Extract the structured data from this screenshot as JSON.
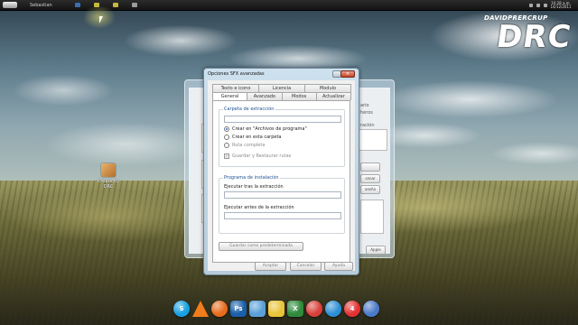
{
  "taskbar": {
    "user": "Sebastian",
    "clock_time": "10:28 a.m.",
    "clock_date": "14/12/2011",
    "buttons": [
      {
        "name": "taskbar-app-1",
        "color": "#3a6fb0"
      },
      {
        "name": "taskbar-app-2",
        "color": "#c7b640"
      },
      {
        "name": "taskbar-app-3",
        "color": "#c7b640"
      },
      {
        "name": "taskbar-app-4",
        "color": "#9b9b9b"
      }
    ]
  },
  "logo": {
    "small_text": "DAVIDPRERCRUP",
    "big_text": "DRC"
  },
  "desktop_icon": {
    "label": "Create by DRC",
    "icon": "package-box-icon"
  },
  "background_window": {
    "labels": [
      "ario",
      "heros",
      "ración",
      "cenar",
      "aseña",
      "Ayuda",
      "Apple"
    ],
    "values": [
      "ovo"
    ]
  },
  "dialog": {
    "title": "Opciones SFX avanzadas",
    "tabs_row1": [
      "Texto e icono",
      "Licencia",
      "Modulo"
    ],
    "tabs_row2": [
      "General",
      "Avanzado",
      "Modos",
      "Actualizar"
    ],
    "group_extract": {
      "title": "Carpeta de extracción",
      "path_value": "",
      "radio_create_program_files": "Crear en \"Archivos de programa\"",
      "radio_create_current": "Crear en esta carpeta",
      "radio_absolute": "Ruta completa",
      "check_save_restore": "Guardar y Restaurar rutas"
    },
    "group_setup": {
      "title": "Programa de instalación",
      "run_after_label": "Ejecutar tras la extracción",
      "run_after_value": "",
      "run_before_label": "Ejecutar antes de la extracción",
      "run_before_value": ""
    },
    "save_default_button": "Guardar como predeterminada",
    "ok_button": "Aceptar",
    "cancel_button": "Cancelar",
    "help_button": "Ayuda",
    "close_glyph": "×"
  },
  "dock": {
    "items": [
      {
        "name": "skype-icon",
        "color": "#18a0e0",
        "glyph": "S",
        "shape": "round"
      },
      {
        "name": "vlc-icon",
        "color": "#f07c1b",
        "glyph": "",
        "shape": "triangle"
      },
      {
        "name": "firefox-icon",
        "color": "#e66b1d",
        "glyph": "",
        "shape": "round"
      },
      {
        "name": "photoshop-icon",
        "color": "#1b5da8",
        "glyph": "Ps",
        "shape": "square"
      },
      {
        "name": "messenger-icon",
        "color": "#5aa0d8",
        "glyph": "",
        "shape": "square"
      },
      {
        "name": "notes-icon",
        "color": "#e8c43a",
        "glyph": "",
        "shape": "square"
      },
      {
        "name": "excel-icon",
        "color": "#2f8a3c",
        "glyph": "X",
        "shape": "square"
      },
      {
        "name": "chrome-icon",
        "color": "#d9403a",
        "glyph": "",
        "shape": "round"
      },
      {
        "name": "safari-icon",
        "color": "#2d8fd5",
        "glyph": "",
        "shape": "round"
      },
      {
        "name": "app-4-icon",
        "color": "#e23232",
        "glyph": "4",
        "shape": "round"
      },
      {
        "name": "itunes-icon",
        "color": "#4b7ac8",
        "glyph": "",
        "shape": "round"
      }
    ]
  }
}
